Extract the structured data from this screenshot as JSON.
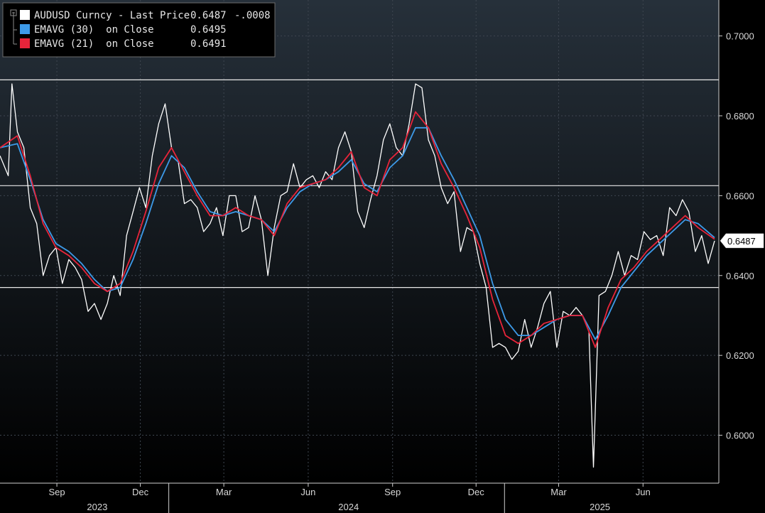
{
  "chart_data": {
    "type": "line",
    "legend": {
      "placement": "top-left",
      "entries": [
        {
          "label": "AUDUSD Curncy - Last Price",
          "value": "0.6487",
          "change": "-.0008",
          "color": "#ffffff"
        },
        {
          "label": "EMAVG (30)  on Close",
          "value": "0.6495",
          "color": "#3d9ae8"
        },
        {
          "label": "EMAVG (21)  on Close",
          "value": "0.6491",
          "color": "#e8243a"
        }
      ]
    },
    "last_price_label": "0.6487",
    "last_price": 0.6487,
    "ylim": [
      0.588,
      0.709
    ],
    "y_ticks": [
      {
        "value": 0.7,
        "label": "0.7000"
      },
      {
        "value": 0.68,
        "label": "0.6800"
      },
      {
        "value": 0.66,
        "label": "0.6600"
      },
      {
        "value": 0.64,
        "label": "0.6400"
      },
      {
        "value": 0.62,
        "label": "0.6200"
      },
      {
        "value": 0.6,
        "label": "0.6000"
      }
    ],
    "horizontal_lines": [
      0.689,
      0.6625,
      0.637
    ],
    "x_range": [
      "2023-07-01",
      "2025-08-18"
    ],
    "x_ticks": [
      {
        "date": "2023-09-01",
        "label": "Sep"
      },
      {
        "date": "2023-12-01",
        "label": "Dec"
      },
      {
        "date": "2024-03-01",
        "label": "Mar"
      },
      {
        "date": "2024-06-01",
        "label": "Jun"
      },
      {
        "date": "2024-09-01",
        "label": "Sep"
      },
      {
        "date": "2024-12-01",
        "label": "Dec"
      },
      {
        "date": "2025-03-01",
        "label": "Mar"
      },
      {
        "date": "2025-06-01",
        "label": "Jun"
      }
    ],
    "year_labels": [
      {
        "date": "2023-10-15",
        "label": "2023"
      },
      {
        "date": "2024-07-15",
        "label": "2024"
      },
      {
        "date": "2025-04-15",
        "label": "2025"
      }
    ],
    "year_dividers": [
      "2024-01-01",
      "2025-01-01"
    ],
    "series": [
      {
        "name": "AUDUSD Curncy - Last Price",
        "color": "#ffffff",
        "points": [
          [
            "2023-07-01",
            0.67
          ],
          [
            "2023-07-10",
            0.665
          ],
          [
            "2023-07-14",
            0.688
          ],
          [
            "2023-07-20",
            0.676
          ],
          [
            "2023-07-27",
            0.672
          ],
          [
            "2023-08-03",
            0.657
          ],
          [
            "2023-08-10",
            0.653
          ],
          [
            "2023-08-17",
            0.64
          ],
          [
            "2023-08-24",
            0.645
          ],
          [
            "2023-08-31",
            0.647
          ],
          [
            "2023-09-07",
            0.638
          ],
          [
            "2023-09-14",
            0.644
          ],
          [
            "2023-09-21",
            0.642
          ],
          [
            "2023-09-28",
            0.639
          ],
          [
            "2023-10-05",
            0.631
          ],
          [
            "2023-10-12",
            0.633
          ],
          [
            "2023-10-19",
            0.629
          ],
          [
            "2023-10-26",
            0.633
          ],
          [
            "2023-11-02",
            0.64
          ],
          [
            "2023-11-09",
            0.635
          ],
          [
            "2023-11-16",
            0.65
          ],
          [
            "2023-11-23",
            0.656
          ],
          [
            "2023-11-30",
            0.662
          ],
          [
            "2023-12-07",
            0.657
          ],
          [
            "2023-12-14",
            0.67
          ],
          [
            "2023-12-21",
            0.678
          ],
          [
            "2023-12-28",
            0.683
          ],
          [
            "2024-01-04",
            0.672
          ],
          [
            "2024-01-11",
            0.669
          ],
          [
            "2024-01-18",
            0.658
          ],
          [
            "2024-01-25",
            0.659
          ],
          [
            "2024-02-01",
            0.657
          ],
          [
            "2024-02-08",
            0.651
          ],
          [
            "2024-02-15",
            0.653
          ],
          [
            "2024-02-22",
            0.657
          ],
          [
            "2024-02-29",
            0.65
          ],
          [
            "2024-03-07",
            0.66
          ],
          [
            "2024-03-14",
            0.66
          ],
          [
            "2024-03-21",
            0.651
          ],
          [
            "2024-03-28",
            0.652
          ],
          [
            "2024-04-04",
            0.66
          ],
          [
            "2024-04-11",
            0.654
          ],
          [
            "2024-04-18",
            0.64
          ],
          [
            "2024-04-25",
            0.652
          ],
          [
            "2024-05-02",
            0.66
          ],
          [
            "2024-05-09",
            0.661
          ],
          [
            "2024-05-16",
            0.668
          ],
          [
            "2024-05-23",
            0.662
          ],
          [
            "2024-05-30",
            0.664
          ],
          [
            "2024-06-06",
            0.665
          ],
          [
            "2024-06-13",
            0.662
          ],
          [
            "2024-06-20",
            0.666
          ],
          [
            "2024-06-27",
            0.664
          ],
          [
            "2024-07-04",
            0.672
          ],
          [
            "2024-07-11",
            0.676
          ],
          [
            "2024-07-18",
            0.671
          ],
          [
            "2024-07-25",
            0.656
          ],
          [
            "2024-08-01",
            0.652
          ],
          [
            "2024-08-08",
            0.659
          ],
          [
            "2024-08-15",
            0.665
          ],
          [
            "2024-08-22",
            0.674
          ],
          [
            "2024-08-29",
            0.678
          ],
          [
            "2024-09-05",
            0.672
          ],
          [
            "2024-09-12",
            0.67
          ],
          [
            "2024-09-19",
            0.678
          ],
          [
            "2024-09-26",
            0.688
          ],
          [
            "2024-10-03",
            0.687
          ],
          [
            "2024-10-10",
            0.674
          ],
          [
            "2024-10-17",
            0.67
          ],
          [
            "2024-10-24",
            0.662
          ],
          [
            "2024-10-31",
            0.658
          ],
          [
            "2024-11-07",
            0.661
          ],
          [
            "2024-11-14",
            0.646
          ],
          [
            "2024-11-21",
            0.652
          ],
          [
            "2024-11-28",
            0.651
          ],
          [
            "2024-12-05",
            0.643
          ],
          [
            "2024-12-12",
            0.637
          ],
          [
            "2024-12-19",
            0.622
          ],
          [
            "2024-12-26",
            0.623
          ],
          [
            "2025-01-02",
            0.622
          ],
          [
            "2025-01-09",
            0.619
          ],
          [
            "2025-01-16",
            0.621
          ],
          [
            "2025-01-23",
            0.629
          ],
          [
            "2025-01-30",
            0.622
          ],
          [
            "2025-02-06",
            0.627
          ],
          [
            "2025-02-13",
            0.633
          ],
          [
            "2025-02-20",
            0.636
          ],
          [
            "2025-02-27",
            0.622
          ],
          [
            "2025-03-06",
            0.631
          ],
          [
            "2025-03-13",
            0.63
          ],
          [
            "2025-03-20",
            0.632
          ],
          [
            "2025-03-27",
            0.63
          ],
          [
            "2025-04-03",
            0.626
          ],
          [
            "2025-04-08",
            0.592
          ],
          [
            "2025-04-14",
            0.635
          ],
          [
            "2025-04-21",
            0.636
          ],
          [
            "2025-04-28",
            0.64
          ],
          [
            "2025-05-05",
            0.646
          ],
          [
            "2025-05-12",
            0.64
          ],
          [
            "2025-05-19",
            0.645
          ],
          [
            "2025-05-26",
            0.644
          ],
          [
            "2025-06-02",
            0.651
          ],
          [
            "2025-06-09",
            0.649
          ],
          [
            "2025-06-16",
            0.65
          ],
          [
            "2025-06-23",
            0.645
          ],
          [
            "2025-06-30",
            0.657
          ],
          [
            "2025-07-07",
            0.655
          ],
          [
            "2025-07-14",
            0.659
          ],
          [
            "2025-07-21",
            0.656
          ],
          [
            "2025-07-28",
            0.646
          ],
          [
            "2025-08-04",
            0.65
          ],
          [
            "2025-08-11",
            0.643
          ],
          [
            "2025-08-18",
            0.6487
          ]
        ]
      },
      {
        "name": "EMAVG (30)  on Close",
        "color": "#3d9ae8",
        "points": [
          [
            "2023-07-01",
            0.672
          ],
          [
            "2023-07-20",
            0.673
          ],
          [
            "2023-08-03",
            0.664
          ],
          [
            "2023-08-17",
            0.654
          ],
          [
            "2023-08-31",
            0.648
          ],
          [
            "2023-09-14",
            0.646
          ],
          [
            "2023-09-28",
            0.643
          ],
          [
            "2023-10-12",
            0.639
          ],
          [
            "2023-10-26",
            0.636
          ],
          [
            "2023-11-09",
            0.637
          ],
          [
            "2023-11-23",
            0.644
          ],
          [
            "2023-12-07",
            0.653
          ],
          [
            "2023-12-21",
            0.663
          ],
          [
            "2024-01-04",
            0.67
          ],
          [
            "2024-01-18",
            0.667
          ],
          [
            "2024-02-01",
            0.661
          ],
          [
            "2024-02-15",
            0.656
          ],
          [
            "2024-02-29",
            0.655
          ],
          [
            "2024-03-14",
            0.656
          ],
          [
            "2024-03-28",
            0.655
          ],
          [
            "2024-04-11",
            0.654
          ],
          [
            "2024-04-25",
            0.651
          ],
          [
            "2024-05-09",
            0.657
          ],
          [
            "2024-05-23",
            0.661
          ],
          [
            "2024-06-06",
            0.663
          ],
          [
            "2024-06-20",
            0.664
          ],
          [
            "2024-07-04",
            0.666
          ],
          [
            "2024-07-18",
            0.669
          ],
          [
            "2024-08-01",
            0.663
          ],
          [
            "2024-08-15",
            0.661
          ],
          [
            "2024-08-29",
            0.667
          ],
          [
            "2024-09-12",
            0.67
          ],
          [
            "2024-09-26",
            0.677
          ],
          [
            "2024-10-10",
            0.677
          ],
          [
            "2024-10-24",
            0.67
          ],
          [
            "2024-11-07",
            0.664
          ],
          [
            "2024-11-21",
            0.657
          ],
          [
            "2024-12-05",
            0.65
          ],
          [
            "2024-12-19",
            0.638
          ],
          [
            "2025-01-02",
            0.629
          ],
          [
            "2025-01-16",
            0.625
          ],
          [
            "2025-01-30",
            0.625
          ],
          [
            "2025-02-13",
            0.627
          ],
          [
            "2025-02-27",
            0.629
          ],
          [
            "2025-03-13",
            0.63
          ],
          [
            "2025-03-27",
            0.63
          ],
          [
            "2025-04-10",
            0.624
          ],
          [
            "2025-04-24",
            0.63
          ],
          [
            "2025-05-08",
            0.637
          ],
          [
            "2025-05-22",
            0.641
          ],
          [
            "2025-06-05",
            0.645
          ],
          [
            "2025-06-19",
            0.648
          ],
          [
            "2025-07-03",
            0.651
          ],
          [
            "2025-07-17",
            0.654
          ],
          [
            "2025-07-31",
            0.653
          ],
          [
            "2025-08-18",
            0.6495
          ]
        ]
      },
      {
        "name": "EMAVG (21)  on Close",
        "color": "#e8243a",
        "points": [
          [
            "2023-07-01",
            0.672
          ],
          [
            "2023-07-20",
            0.675
          ],
          [
            "2023-08-03",
            0.665
          ],
          [
            "2023-08-17",
            0.653
          ],
          [
            "2023-08-31",
            0.647
          ],
          [
            "2023-09-14",
            0.645
          ],
          [
            "2023-09-28",
            0.642
          ],
          [
            "2023-10-12",
            0.638
          ],
          [
            "2023-10-26",
            0.636
          ],
          [
            "2023-11-09",
            0.638
          ],
          [
            "2023-11-23",
            0.646
          ],
          [
            "2023-12-07",
            0.656
          ],
          [
            "2023-12-21",
            0.667
          ],
          [
            "2024-01-04",
            0.672
          ],
          [
            "2024-01-18",
            0.666
          ],
          [
            "2024-02-01",
            0.66
          ],
          [
            "2024-02-15",
            0.655
          ],
          [
            "2024-02-29",
            0.655
          ],
          [
            "2024-03-14",
            0.657
          ],
          [
            "2024-03-28",
            0.655
          ],
          [
            "2024-04-11",
            0.654
          ],
          [
            "2024-04-25",
            0.65
          ],
          [
            "2024-05-09",
            0.658
          ],
          [
            "2024-05-23",
            0.662
          ],
          [
            "2024-06-06",
            0.663
          ],
          [
            "2024-06-20",
            0.664
          ],
          [
            "2024-07-04",
            0.667
          ],
          [
            "2024-07-18",
            0.671
          ],
          [
            "2024-08-01",
            0.662
          ],
          [
            "2024-08-15",
            0.66
          ],
          [
            "2024-08-29",
            0.669
          ],
          [
            "2024-09-12",
            0.672
          ],
          [
            "2024-09-26",
            0.681
          ],
          [
            "2024-10-10",
            0.677
          ],
          [
            "2024-10-24",
            0.668
          ],
          [
            "2024-11-07",
            0.662
          ],
          [
            "2024-11-21",
            0.655
          ],
          [
            "2024-12-05",
            0.647
          ],
          [
            "2024-12-19",
            0.634
          ],
          [
            "2025-01-02",
            0.625
          ],
          [
            "2025-01-16",
            0.623
          ],
          [
            "2025-01-30",
            0.625
          ],
          [
            "2025-02-13",
            0.628
          ],
          [
            "2025-02-27",
            0.629
          ],
          [
            "2025-03-13",
            0.63
          ],
          [
            "2025-03-27",
            0.63
          ],
          [
            "2025-04-10",
            0.622
          ],
          [
            "2025-04-24",
            0.632
          ],
          [
            "2025-05-08",
            0.639
          ],
          [
            "2025-05-22",
            0.642
          ],
          [
            "2025-06-05",
            0.646
          ],
          [
            "2025-06-19",
            0.649
          ],
          [
            "2025-07-03",
            0.652
          ],
          [
            "2025-07-17",
            0.655
          ],
          [
            "2025-07-31",
            0.652
          ],
          [
            "2025-08-18",
            0.6491
          ]
        ]
      }
    ]
  }
}
